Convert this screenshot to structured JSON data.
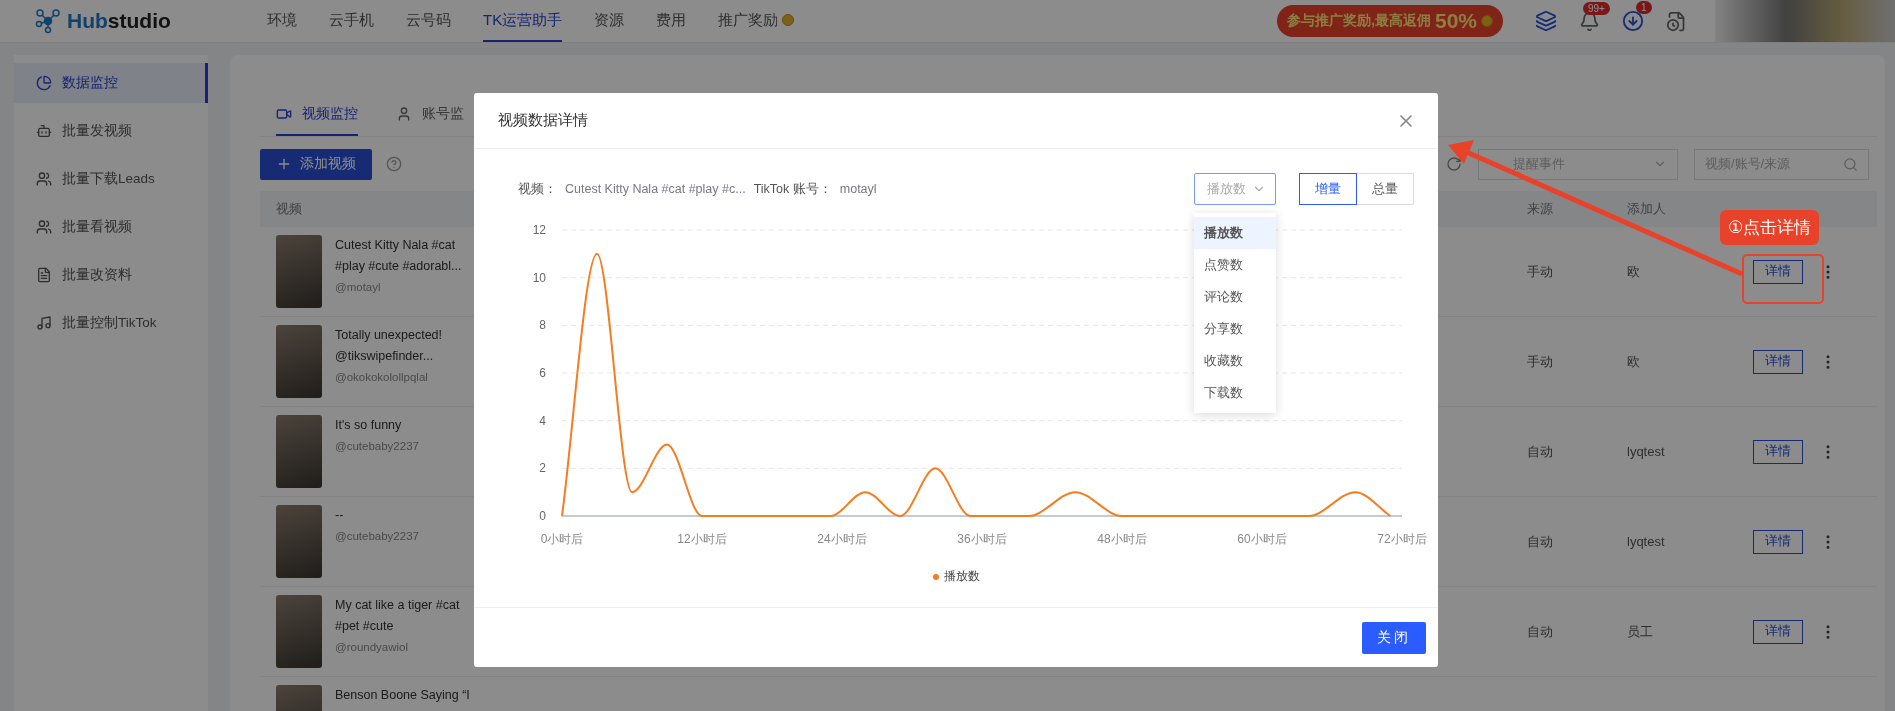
{
  "topbar": {
    "logo": {
      "prefix": "Hub",
      "suffix": "studio"
    },
    "nav": [
      {
        "label": "环境",
        "selected": false
      },
      {
        "label": "云手机",
        "selected": false
      },
      {
        "label": "云号码",
        "selected": false
      },
      {
        "label": "TK运营助手",
        "selected": true
      },
      {
        "label": "资源",
        "selected": false
      },
      {
        "label": "费用",
        "selected": false
      },
      {
        "label": "推广奖励",
        "selected": false
      }
    ],
    "promo": {
      "text": "参与推广奖励,最高返佣",
      "highlight": "50%"
    },
    "notifications_badge": "99+",
    "downloads_badge": "1"
  },
  "sidebar": {
    "items": [
      {
        "label": "数据监控",
        "selected": true
      },
      {
        "label": "批量发视频",
        "selected": false
      },
      {
        "label": "批量下载Leads",
        "selected": false
      },
      {
        "label": "批量看视频",
        "selected": false
      },
      {
        "label": "批量改资料",
        "selected": false
      },
      {
        "label": "批量控制TikTok",
        "selected": false
      }
    ]
  },
  "tabs": [
    {
      "label": "视频监控",
      "selected": true
    },
    {
      "label": "账号监",
      "selected": false
    }
  ],
  "toolbar": {
    "add_button": "添加视频",
    "event_select": {
      "placeholder": "提醒事件"
    },
    "search": {
      "placeholder": "视频/账号/来源"
    }
  },
  "table": {
    "columns": [
      "视频",
      "来源",
      "添加人"
    ],
    "rows": [
      {
        "title": "Cutest Kitty Nala #cat #play #cute #adorabl...",
        "handle": "@motayl",
        "source": "手动",
        "added_by": "欧",
        "action": "详情"
      },
      {
        "title": "Totally unexpected! @tikswipefinder...",
        "handle": "@okokokolollpqlal",
        "source": "手动",
        "added_by": "欧",
        "action": "详情"
      },
      {
        "title": "It's so funny",
        "handle": "@cutebaby2237",
        "source": "自动",
        "added_by": "lyqtest",
        "action": "详情"
      },
      {
        "title": "--",
        "handle": "@cutebaby2237",
        "source": "自动",
        "added_by": "lyqtest",
        "action": "详情"
      },
      {
        "title": "My cat like a tiger #cat #pet #cute",
        "handle": "@roundyawiol",
        "source": "自动",
        "added_by": "员工",
        "action": "详情"
      },
      {
        "title": "Benson Boone Saying “I"
      }
    ]
  },
  "dialog": {
    "title": "视频数据详情",
    "info": {
      "video_label": "视频：",
      "video": "Cutest Kitty Nala #cat #play #c...",
      "account_label": "TikTok 账号：",
      "account": "motayl"
    },
    "metric_select": {
      "value": "播放数",
      "expanded": true,
      "options": [
        {
          "label": "播放数",
          "selected": true
        },
        {
          "label": "点赞数",
          "selected": false
        },
        {
          "label": "评论数",
          "selected": false
        },
        {
          "label": "分享数",
          "selected": false
        },
        {
          "label": "收藏数",
          "selected": false
        },
        {
          "label": "下载数",
          "selected": false
        }
      ]
    },
    "mode": [
      {
        "label": "增量",
        "selected": true
      },
      {
        "label": "总量",
        "selected": false
      }
    ],
    "chart_data": {
      "type": "line",
      "x": [
        0,
        3,
        6,
        9,
        12,
        23,
        26,
        29,
        32,
        35,
        40,
        44,
        48,
        64,
        68,
        71
      ],
      "series": [
        {
          "name": "播放数",
          "color": "#f57c1f",
          "values": [
            0,
            11,
            1,
            3,
            0,
            0,
            1,
            0,
            2,
            0,
            0,
            1,
            0,
            0,
            1,
            0
          ]
        }
      ],
      "xlim": [
        0,
        72
      ],
      "ylim": [
        0,
        12
      ],
      "grid": true,
      "xticks": [
        {
          "value": 0,
          "label": "0小时后"
        },
        {
          "value": 12,
          "label": "12小时后"
        },
        {
          "value": 24,
          "label": "24小时后"
        },
        {
          "value": 36,
          "label": "36小时后"
        },
        {
          "value": 48,
          "label": "48小时后"
        },
        {
          "value": 60,
          "label": "60小时后"
        },
        {
          "value": 72,
          "label": "72小时后"
        }
      ],
      "yticks": [
        0,
        2,
        4,
        6,
        8,
        10,
        12
      ]
    },
    "close_button": "关闭"
  },
  "annotation": {
    "callout": "①点击详情"
  }
}
